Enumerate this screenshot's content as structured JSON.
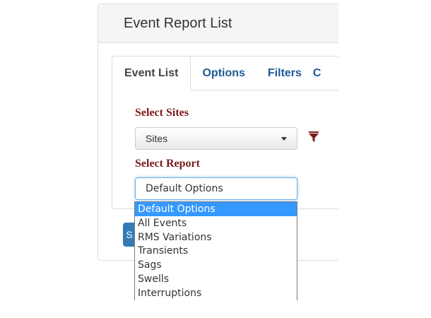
{
  "panel": {
    "title": "Event Report List"
  },
  "tabs": [
    {
      "label": "Event List",
      "active": true
    },
    {
      "label": "Options",
      "active": false
    },
    {
      "label": "Filters",
      "active": false
    },
    {
      "label": "C",
      "active": false
    }
  ],
  "select_sites": {
    "label": "Select Sites",
    "value": "Sites"
  },
  "filter_icon": {
    "name": "filter-icon",
    "color": "#7a1a1a"
  },
  "select_report": {
    "label": "Select Report",
    "value": "Default Options",
    "options": [
      "Default Options",
      "All Events",
      "RMS Variations",
      "Transients",
      "Sags",
      "Swells",
      "Interruptions"
    ],
    "highlighted": "Default Options"
  },
  "button": {
    "label": "S"
  },
  "colors": {
    "accent": "#1e5a96",
    "label": "#7a1a1a",
    "highlight": "#3399ff",
    "primary_button": "#337ab7"
  }
}
